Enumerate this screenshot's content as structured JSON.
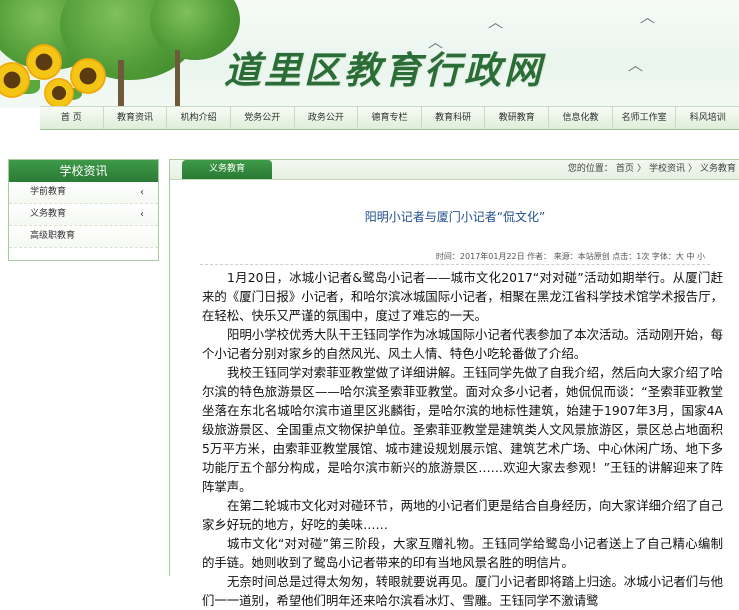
{
  "site": {
    "title": "道里区教育行政网"
  },
  "nav": {
    "items": [
      "首 页",
      "教育资讯",
      "机构介绍",
      "党务公开",
      "政务公开",
      "德育专栏",
      "教育科研",
      "教研教育",
      "信息化教",
      "名师工作室",
      "科风培训"
    ]
  },
  "sidebar": {
    "title": "学校资讯",
    "items": [
      {
        "label": "学前教育",
        "chevron": "‹"
      },
      {
        "label": "义务教育",
        "chevron": "‹"
      },
      {
        "label": "高级职教育",
        "chevron": ""
      }
    ]
  },
  "main": {
    "active_tab": "义务教育",
    "breadcrumb": {
      "prefix": "您的位置：",
      "home": "首页",
      "sep1": "〉",
      "section": "学校资讯",
      "sep2": "〉",
      "current": "义务教育"
    },
    "article": {
      "title": "阳明小记者与厦门小记者“侃文化”",
      "meta": "时间：2017年01月22日  作者：  来源：本站原创  点击：1次  字体：大  中  小",
      "paragraphs": [
        "1月20日，冰城小记者&鹭岛小记者——城市文化2017“对对碰”活动如期举行。从厦门赶来的《厦门日报》小记者，和哈尔滨冰城国际小记者，相聚在黑龙江省科学技术馆学术报告厅，在轻松、快乐又严谨的氛围中，度过了难忘的一天。",
        "阳明小学校优秀大队干王钰同学作为冰城国际小记者代表参加了本次活动。活动刚开始，每个小记者分别对家乡的自然风光、风土人情、特色小吃轮番做了介绍。",
        "我校王钰同学对索菲亚教堂做了详细讲解。王钰同学先做了自我介绍，然后向大家介绍了哈尔滨的特色旅游景区——哈尔滨圣索菲亚教堂。面对众多小记者，她侃侃而谈：“圣索菲亚教堂坐落在东北名城哈尔滨市道里区兆麟街，是哈尔滨的地标性建筑，始建于1907年3月，国家4A级旅游景区、全国重点文物保护单位。圣索菲亚教堂是建筑类人文风景旅游区，景区总占地面积5万平方米，由索菲亚教堂展馆、城市建设规划展示馆、建筑艺术广场、中心休闲广场、地下多功能厅五个部分构成，是哈尔滨市新兴的旅游景区……欢迎大家去参观！”王钰的讲解迎来了阵阵掌声。",
        "在第二轮城市文化对对碰环节，两地的小记者们更是结合自身经历，向大家详细介绍了自己家乡好玩的地方，好吃的美味……",
        "城市文化“对对碰”第三阶段，大家互赠礼物。王钰同学给鹭岛小记者送上了自己精心编制的手链。她则收到了鹭岛小记者带来的印有当地风景名胜的明信片。",
        "无奈时间总是过得太匆匆，转眼就要说再见。厦门小记者即将踏上归途。冰城小记者们与他们一一道别，希望他们明年还来哈尔滨看冰灯、雪雕。王钰同学不激请鹭"
      ]
    }
  },
  "colors": {
    "brand_green": "#2b7a35",
    "title_blue": "#1f4e8c",
    "nav_bg": "#dfeed9"
  }
}
